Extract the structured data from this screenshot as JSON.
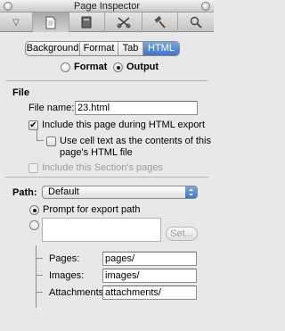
{
  "window": {
    "title": "Page Inspector"
  },
  "toolbar": {
    "tools": [
      {
        "name": "triangle-icon",
        "glyph": "▽"
      },
      {
        "name": "page-icon",
        "glyph": "▯"
      },
      {
        "name": "book-icon",
        "glyph": "▮"
      },
      {
        "name": "tools-icon",
        "glyph": "✂"
      },
      {
        "name": "hammer-icon",
        "glyph": "⚒"
      },
      {
        "name": "search-icon",
        "glyph": "⌕"
      }
    ]
  },
  "tabs": [
    "Background",
    "Format",
    "Tab",
    "HTML"
  ],
  "mode": {
    "format_label": "Format",
    "output_label": "Output"
  },
  "file": {
    "section_label": "File",
    "name_label": "File name:",
    "name_value": "23.html",
    "include_label": "Include this page during HTML export",
    "cell_text_line1": "Use cell text as the contents of this",
    "cell_text_line2": "page's HTML file",
    "section_pages_label": "Include this Section's pages"
  },
  "path": {
    "label": "Path:",
    "selected": "Default",
    "prompt_label": "Prompt for export path",
    "set_button": "Set...",
    "pages_label": "Pages:",
    "pages_value": "pages/",
    "images_label": "Images:",
    "images_value": "images/",
    "attachments_label": "Attachments:",
    "attachments_value": "attachments/"
  },
  "colors": {
    "accent": "#3c76c8"
  }
}
